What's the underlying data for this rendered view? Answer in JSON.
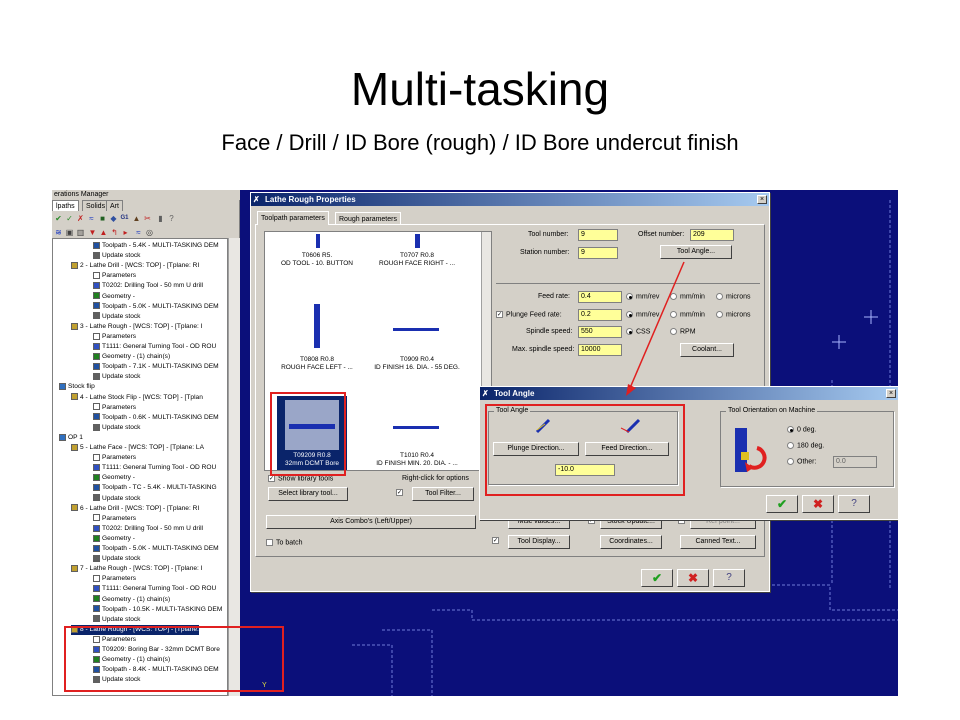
{
  "slide": {
    "title": "Multi-tasking",
    "subtitle": "Face / Drill / ID Bore (rough) / ID Bore undercut finish"
  },
  "ops_manager": {
    "header": "erations Manager",
    "tabs": [
      "lpaths",
      "Solids",
      "Art"
    ],
    "tree": [
      {
        "text": "Toolpath - 5.4K - MULTI-TASKING DEM",
        "icon": "toolpath-icon"
      },
      {
        "text": "Update stock",
        "icon": "stock-icon"
      },
      {
        "text": "2 - Lathe Drill - [WCS: TOP] - [Tplane: RI",
        "icon": "folder-icon"
      },
      {
        "text": "Parameters",
        "icon": "params-icon"
      },
      {
        "text": "T0202: Drilling Tool - 50 mm U drill",
        "icon": "tool-icon"
      },
      {
        "text": "Geometry -",
        "icon": "geometry-icon"
      },
      {
        "text": "Toolpath - 5.0K - MULTI-TASKING DEM",
        "icon": "toolpath-icon"
      },
      {
        "text": "Update stock",
        "icon": "stock-icon"
      },
      {
        "text": "3 - Lathe Rough - [WCS: TOP] - [Tplane: I",
        "icon": "folder-icon"
      },
      {
        "text": "Parameters",
        "icon": "params-icon"
      },
      {
        "text": "T1111: General Turning Tool - OD ROU",
        "icon": "tool-icon"
      },
      {
        "text": "Geometry - (1) chain(s)",
        "icon": "geometry-icon"
      },
      {
        "text": "Toolpath - 7.1K - MULTI-TASKING DEM",
        "icon": "toolpath-icon"
      },
      {
        "text": "Update stock",
        "icon": "stock-icon"
      },
      {
        "text": "Stock flip",
        "icon": "stockflip-icon"
      },
      {
        "text": "4 - Lathe Stock Flip - [WCS: TOP] - [Tplan",
        "icon": "folder-icon"
      },
      {
        "text": "Parameters",
        "icon": "params-icon"
      },
      {
        "text": "Toolpath - 0.6K - MULTI-TASKING DEM",
        "icon": "toolpath-icon"
      },
      {
        "text": "Update stock",
        "icon": "stock-icon"
      },
      {
        "text": "OP 1",
        "icon": "op-icon"
      },
      {
        "text": "5 - Lathe Face - [WCS: TOP] - [Tplane: LA",
        "icon": "folder-icon"
      },
      {
        "text": "Parameters",
        "icon": "params-icon"
      },
      {
        "text": "T1111: General Turning Tool - OD ROU",
        "icon": "tool-icon"
      },
      {
        "text": "Geometry -",
        "icon": "geometry-icon"
      },
      {
        "text": "Toolpath - TC - 5.4K - MULTI-TASKING",
        "icon": "toolpath-icon"
      },
      {
        "text": "Update stock",
        "icon": "stock-icon"
      },
      {
        "text": "6 - Lathe Drill - [WCS: TOP] - [Tplane: RI",
        "icon": "folder-icon"
      },
      {
        "text": "Parameters",
        "icon": "params-icon"
      },
      {
        "text": "T0202: Drilling Tool - 50 mm U drill",
        "icon": "tool-icon"
      },
      {
        "text": "Geometry -",
        "icon": "geometry-icon"
      },
      {
        "text": "Toolpath - 5.0K - MULTI-TASKING DEM",
        "icon": "toolpath-icon"
      },
      {
        "text": "Update stock",
        "icon": "stock-icon"
      },
      {
        "text": "7 - Lathe Rough - [WCS: TOP] - [Tplane: I",
        "icon": "folder-icon"
      },
      {
        "text": "Parameters",
        "icon": "params-icon"
      },
      {
        "text": "T1111: General Turning Tool - OD ROU",
        "icon": "tool-icon"
      },
      {
        "text": "Geometry - (1) chain(s)",
        "icon": "geometry-icon"
      },
      {
        "text": "Toolpath - 10.5K - MULTI-TASKING DEM",
        "icon": "toolpath-icon"
      },
      {
        "text": "Update stock",
        "icon": "stock-icon"
      },
      {
        "text": "8 - Lathe Rough - [WCS: TOP] - [Tplane: ",
        "icon": "folder-icon",
        "selected": true
      },
      {
        "text": "Parameters",
        "icon": "params-icon"
      },
      {
        "text": "T09209: Boring Bar - 32mm DCMT Bore",
        "icon": "tool-icon"
      },
      {
        "text": "Geometry - (1) chain(s)",
        "icon": "geometry-icon"
      },
      {
        "text": "Toolpath - 8.4K - MULTI-TASKING DEM",
        "icon": "toolpath-icon"
      },
      {
        "text": "Update stock",
        "icon": "stock-icon"
      }
    ]
  },
  "rough_dialog": {
    "title": "Lathe Rough Properties",
    "tabs": [
      "Toolpath parameters",
      "Rough parameters"
    ],
    "tools": [
      {
        "line1": "T0606 R5.",
        "line2": "OD TOOL - 10. BUTTON"
      },
      {
        "line1": "T0707 R0.8",
        "line2": "ROUGH FACE RIGHT - ..."
      },
      {
        "line1": "T0808 R0.8",
        "line2": "ROUGH FACE LEFT - ..."
      },
      {
        "line1": "T0909 R0.4",
        "line2": "ID FINISH 16. DIA. - 55 DEG."
      },
      {
        "line1": "T09209 R0.8",
        "line2": "32mm DCMT Bore"
      },
      {
        "line1": "T1010 R0.4",
        "line2": "ID FINISH MIN. 20. DIA. - ..."
      }
    ],
    "show_library_tools": "Show library tools",
    "right_click_hint": "Right-click for options",
    "select_library_tool": "Select library tool...",
    "tool_filter": "Tool Filter...",
    "tool_number_label": "Tool number:",
    "tool_number": "9",
    "offset_number_label": "Offset number:",
    "offset_number": "209",
    "station_number_label": "Station number:",
    "station_number": "9",
    "tool_angle_button": "Tool Angle...",
    "feed_rate_label": "Feed rate:",
    "feed_rate": "0.4",
    "plunge_feed_label": "Plunge Feed rate:",
    "plunge_feed": "0.2",
    "spindle_speed_label": "Spindle speed:",
    "spindle_speed": "550",
    "max_spindle_label": "Max. spindle speed:",
    "max_spindle": "10000",
    "units": [
      "mm/rev",
      "mm/min",
      "microns"
    ],
    "css": "CSS",
    "rpm": "RPM",
    "coolant": "Coolant...",
    "axis_combos": "Axis Combo's (Left/Upper)",
    "to_batch": "To batch",
    "misc_values": "Misc values...",
    "stock_update": "Stock Update...",
    "ref_point": "Ref point...",
    "tool_display": "Tool Display...",
    "coordinates": "Coordinates...",
    "canned_text": "Canned Text..."
  },
  "tool_angle_dialog": {
    "title": "Tool Angle",
    "group": "Tool Angle",
    "plunge_direction": "Plunge Direction...",
    "feed_direction": "Feed Direction...",
    "angle_value": "-10.0",
    "orientation_group": "Tool Orientation on Machine",
    "opt_0": "0 deg.",
    "opt_180": "180 deg.",
    "opt_other": "Other:",
    "other_value": "0.0"
  },
  "colors": {
    "background": "#0b0f7a",
    "highlight": "#e02020",
    "input": "#ffff99",
    "ok": "#20a020",
    "cancel": "#d02020"
  }
}
